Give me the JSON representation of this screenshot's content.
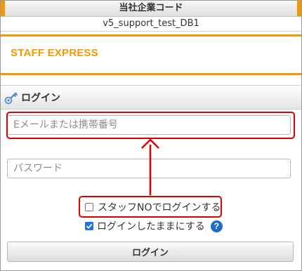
{
  "header": {
    "company_code_label": "当社企業コード",
    "company_code_value": "v5_support_test_DB1"
  },
  "brand": {
    "logo_text": "STAFF EXPRESS",
    "color": "#f39800"
  },
  "section": {
    "title": "ログイン",
    "icon": "key-icon"
  },
  "form": {
    "email_placeholder": "Eメールまたは携帯番号",
    "password_placeholder": "パスワード",
    "staff_no_login_label": "スタッフNOでログインする",
    "staff_no_login_checked": false,
    "keep_logged_in_label": "ログインしたままにする",
    "keep_logged_in_checked": true,
    "help_icon": "question-icon",
    "submit_label": "ログイン"
  },
  "annotation": {
    "color": "#e00000"
  }
}
